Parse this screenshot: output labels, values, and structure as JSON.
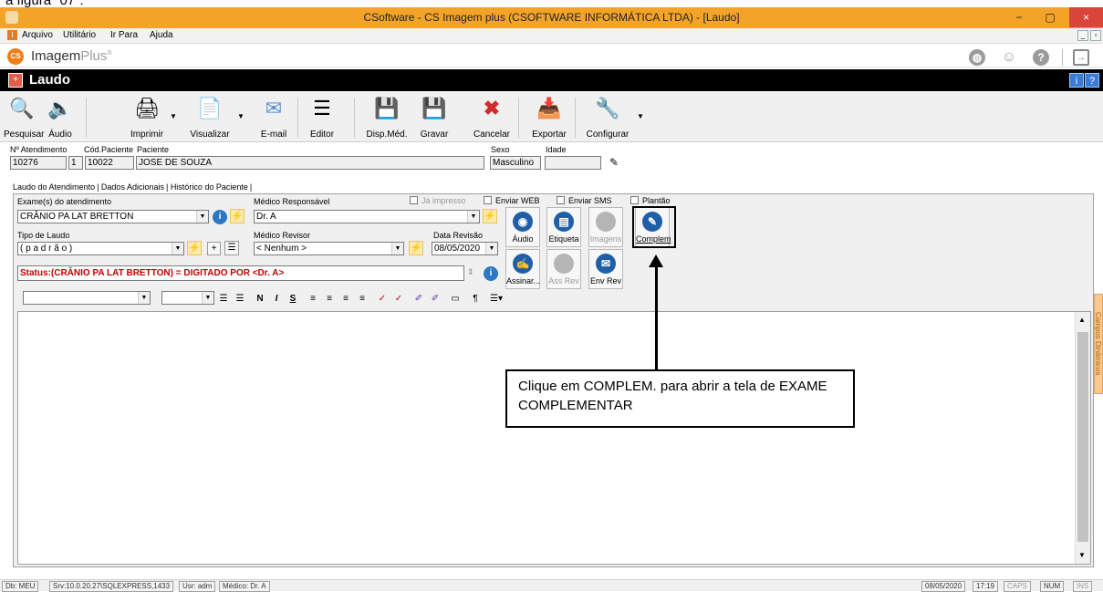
{
  "window": {
    "top_cut_text": "a figura \"07\".",
    "title": "CSoftware - CS Imagem plus (CSOFTWARE INFORMÁTICA LTDA) - [Laudo]",
    "minimize": "−",
    "maximize": "▢",
    "close": "×"
  },
  "menu": {
    "items": [
      "Arquivo",
      "Utilitário",
      "Ir Para",
      "Ajuda"
    ]
  },
  "brand": {
    "name_main": "Imagem",
    "name_light": "Plus",
    "reg": "®"
  },
  "module": {
    "title": "Laudo"
  },
  "toolbar": {
    "pesquisar": "Pesquisar",
    "audio": "Áudio",
    "imprimir": "Imprimir",
    "visualizar": "Visualizar",
    "email": "E-mail",
    "editor": "Editor",
    "disp_med": "Disp.Méd.",
    "gravar": "Gravar",
    "cancelar": "Cancelar",
    "exportar": "Exportar",
    "configurar": "Configurar"
  },
  "patient": {
    "label_atendimento": "Nº Atendimento",
    "label_cod": "Cód.Paciente",
    "label_paciente": "Paciente",
    "label_sexo": "Sexo",
    "label_idade": "Idade",
    "atendimento": "10276",
    "seq": "1",
    "cod": "10022",
    "nome": "JOSE DE SOUZA",
    "sexo": "Masculino",
    "idade": ""
  },
  "tabs": [
    "Laudo do Atendimento",
    "Dados Adicionais",
    "Histórico do Paciente"
  ],
  "laudo": {
    "label_exames": "Exame(s) do atendimento",
    "exame": "CRÂNIO PA LAT BRETTON",
    "label_medico_resp": "Médico Responsável",
    "medico_resp": "Dr. A",
    "label_tipo": "Tipo de Laudo",
    "tipo": "( p a d r ã o )",
    "label_revisor": "Médico Revisor",
    "revisor": "< Nenhum >",
    "label_data_revisao": "Data Revisão",
    "data_revisao": "08/05/2020",
    "status": "Status:(CRÂNIO PA LAT BRETTON) = DIGITADO POR <Dr. A>"
  },
  "checkboxes": {
    "ja_impresso": "Já impresso",
    "enviar_web": "Enviar WEB",
    "enviar_sms": "Enviar SMS",
    "plantao": "Plantão"
  },
  "actions": {
    "audio": "Áudio",
    "etiqueta": "Etiqueta",
    "imagens": "Imagens",
    "complem": "Complem",
    "assinar": "Assinar...",
    "ass_rev": "Ass Rev",
    "env_rev": "Env Rev"
  },
  "side_tab": "Campos Dinâmicos",
  "callout": {
    "text": "Clique em COMPLEM. para abrir a tela de EXAME COMPLEMENTAR"
  },
  "statusbar": {
    "db": "Db: MEU",
    "srv": "Srv:10.0.20.27\\SQLEXPRESS,1433",
    "usr": "Usr: adm",
    "medico": "Médico: Dr. A",
    "date": "08/05/2020",
    "time": "17:19",
    "caps": "CAPS",
    "num": "NUM",
    "ins": "INS"
  },
  "colors": {
    "titlebar": "#f3a428",
    "status_text": "#c00000",
    "close": "#d9443b"
  }
}
